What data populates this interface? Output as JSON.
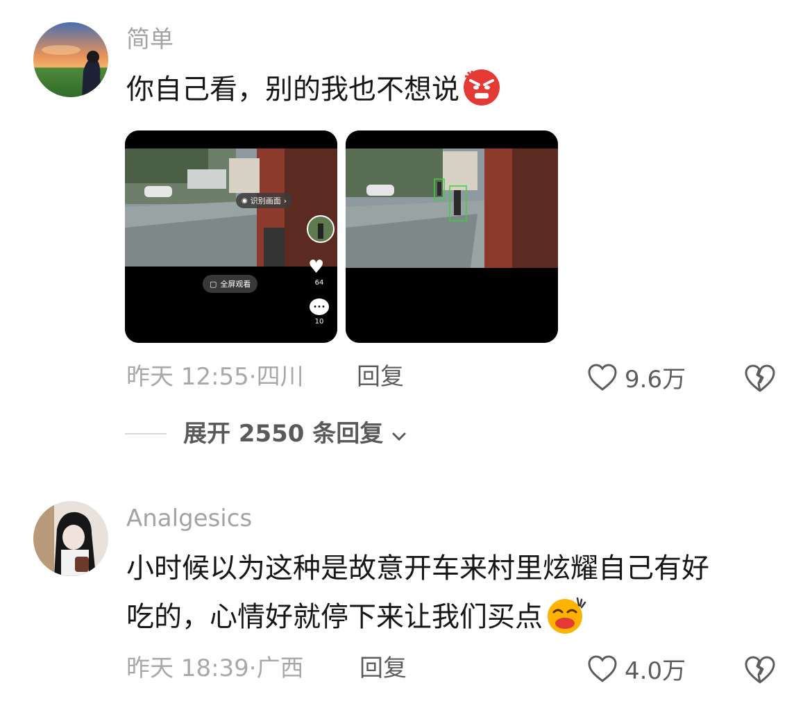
{
  "comments": [
    {
      "username": "简单",
      "text": "你自己看，别的我也不想说",
      "emoji": "angry-face-emoji",
      "time": "昨天 12:55",
      "location": "四川",
      "reply_label": "回复",
      "likes": "9.6万",
      "images": [
        {
          "recognize_label": "识别画面",
          "fullscreen_label": "全屏观看",
          "like_count": "64",
          "comment_count": "10"
        },
        {}
      ],
      "expand_label": "展开 2550 条回复"
    },
    {
      "username": "Analgesics",
      "text_line1": "小时候以为这种是故意开车来村里炫耀自己有好",
      "text_line2": "吃的，心情好就停下来让我们买点",
      "emoji": "laughing-face-emoji",
      "time": "昨天 18:39",
      "location": "广西",
      "reply_label": "回复",
      "likes": "4.0万"
    }
  ],
  "colors": {
    "username": "#a3a3a3",
    "meta": "#a8a8a8",
    "text": "#161616",
    "angry_emoji": "#e53935",
    "laugh_emoji": "#ffb300"
  }
}
